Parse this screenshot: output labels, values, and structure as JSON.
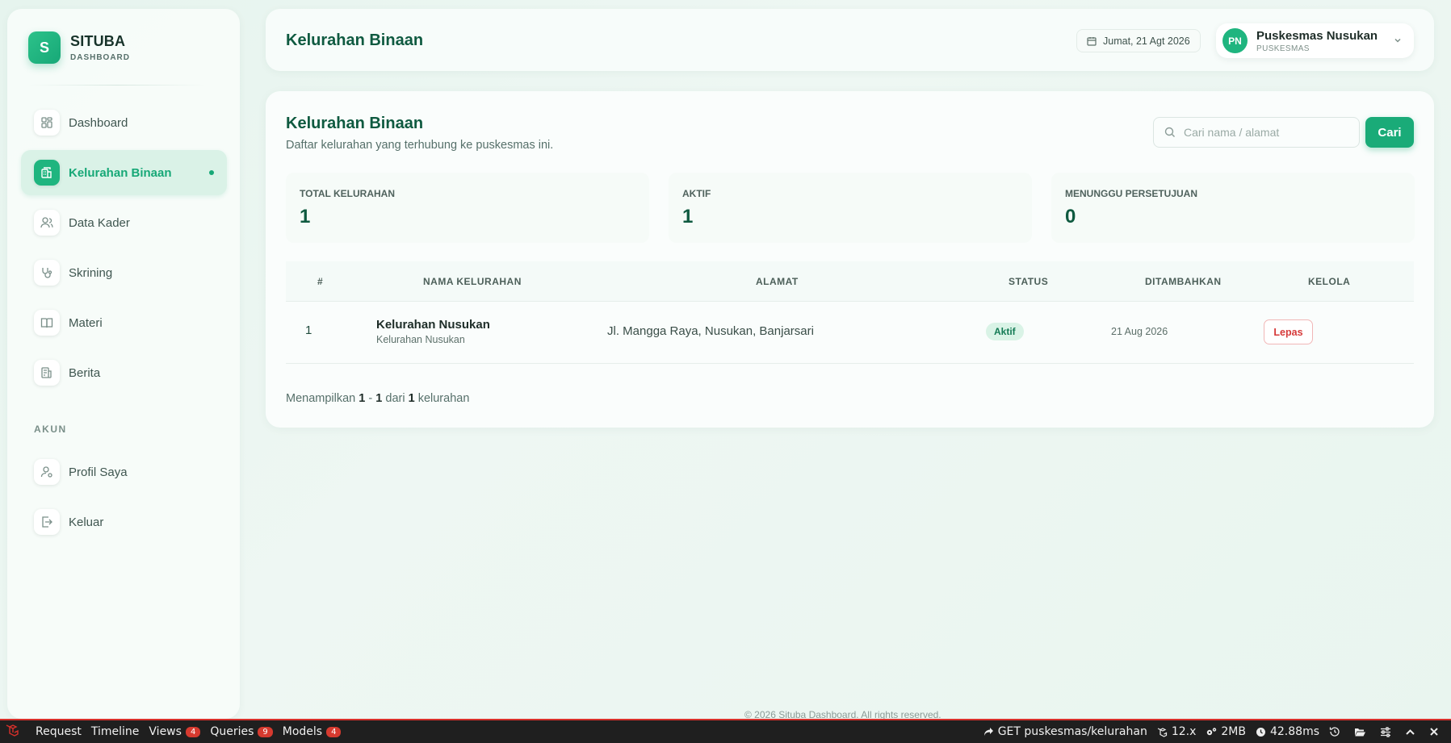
{
  "brand": {
    "logo_letter": "S",
    "name": "SITUBA",
    "sub": "DASHBOARD"
  },
  "sidebar": {
    "items": [
      {
        "label": "Dashboard",
        "icon": "grid-icon"
      },
      {
        "label": "Kelurahan Binaan",
        "icon": "building-icon",
        "active": true
      },
      {
        "label": "Data Kader",
        "icon": "users-icon"
      },
      {
        "label": "Skrining",
        "icon": "stethoscope-icon"
      },
      {
        "label": "Materi",
        "icon": "book-icon"
      },
      {
        "label": "Berita",
        "icon": "news-icon"
      }
    ],
    "section_account": "AKUN",
    "account_items": [
      {
        "label": "Profil Saya",
        "icon": "user-settings-icon"
      },
      {
        "label": "Keluar",
        "icon": "logout-icon"
      }
    ]
  },
  "header": {
    "title": "Kelurahan Binaan",
    "date": "Jumat, 21 Agt 2026",
    "user": {
      "initials": "PN",
      "name": "Puskesmas Nusukan",
      "role": "PUSKESMAS"
    }
  },
  "main": {
    "title": "Kelurahan Binaan",
    "subtitle": "Daftar kelurahan yang terhubung ke puskesmas ini.",
    "search_placeholder": "Cari nama / alamat",
    "search_button": "Cari",
    "stats": [
      {
        "label": "TOTAL KELURAHAN",
        "value": "1"
      },
      {
        "label": "AKTIF",
        "value": "1"
      },
      {
        "label": "MENUNGGU PERSETUJUAN",
        "value": "0"
      }
    ],
    "table": {
      "columns": [
        "#",
        "NAMA KELURAHAN",
        "ALAMAT",
        "STATUS",
        "DITAMBAHKAN",
        "KELOLA"
      ],
      "rows": [
        {
          "no": "1",
          "name": "Kelurahan Nusukan",
          "sub": "Kelurahan Nusukan",
          "alamat": "Jl. Mangga Raya, Nusukan, Banjarsari",
          "status": "Aktif",
          "date": "21 Aug 2026",
          "action": "Lepas"
        }
      ]
    },
    "pagination": {
      "prefix": "Menampilkan",
      "from": "1",
      "sep": "-",
      "to": "1",
      "of": "dari",
      "total": "1",
      "suffix": "kelurahan"
    }
  },
  "footer": {
    "copyright": "© 2026 Situba Dashboard. All rights reserved."
  },
  "debugbar": {
    "tabs": [
      {
        "label": "Request"
      },
      {
        "label": "Timeline"
      },
      {
        "label": "Views",
        "badge": "4"
      },
      {
        "label": "Queries",
        "badge": "9"
      },
      {
        "label": "Models",
        "badge": "4"
      }
    ],
    "route": "GET puskesmas/kelurahan",
    "version": "12.x",
    "memory": "2MB",
    "time": "42.88ms"
  },
  "colors": {
    "accent": "#1aab78",
    "title": "#0f5a40",
    "danger": "#d63a3a",
    "debug_red": "#d7302b"
  }
}
